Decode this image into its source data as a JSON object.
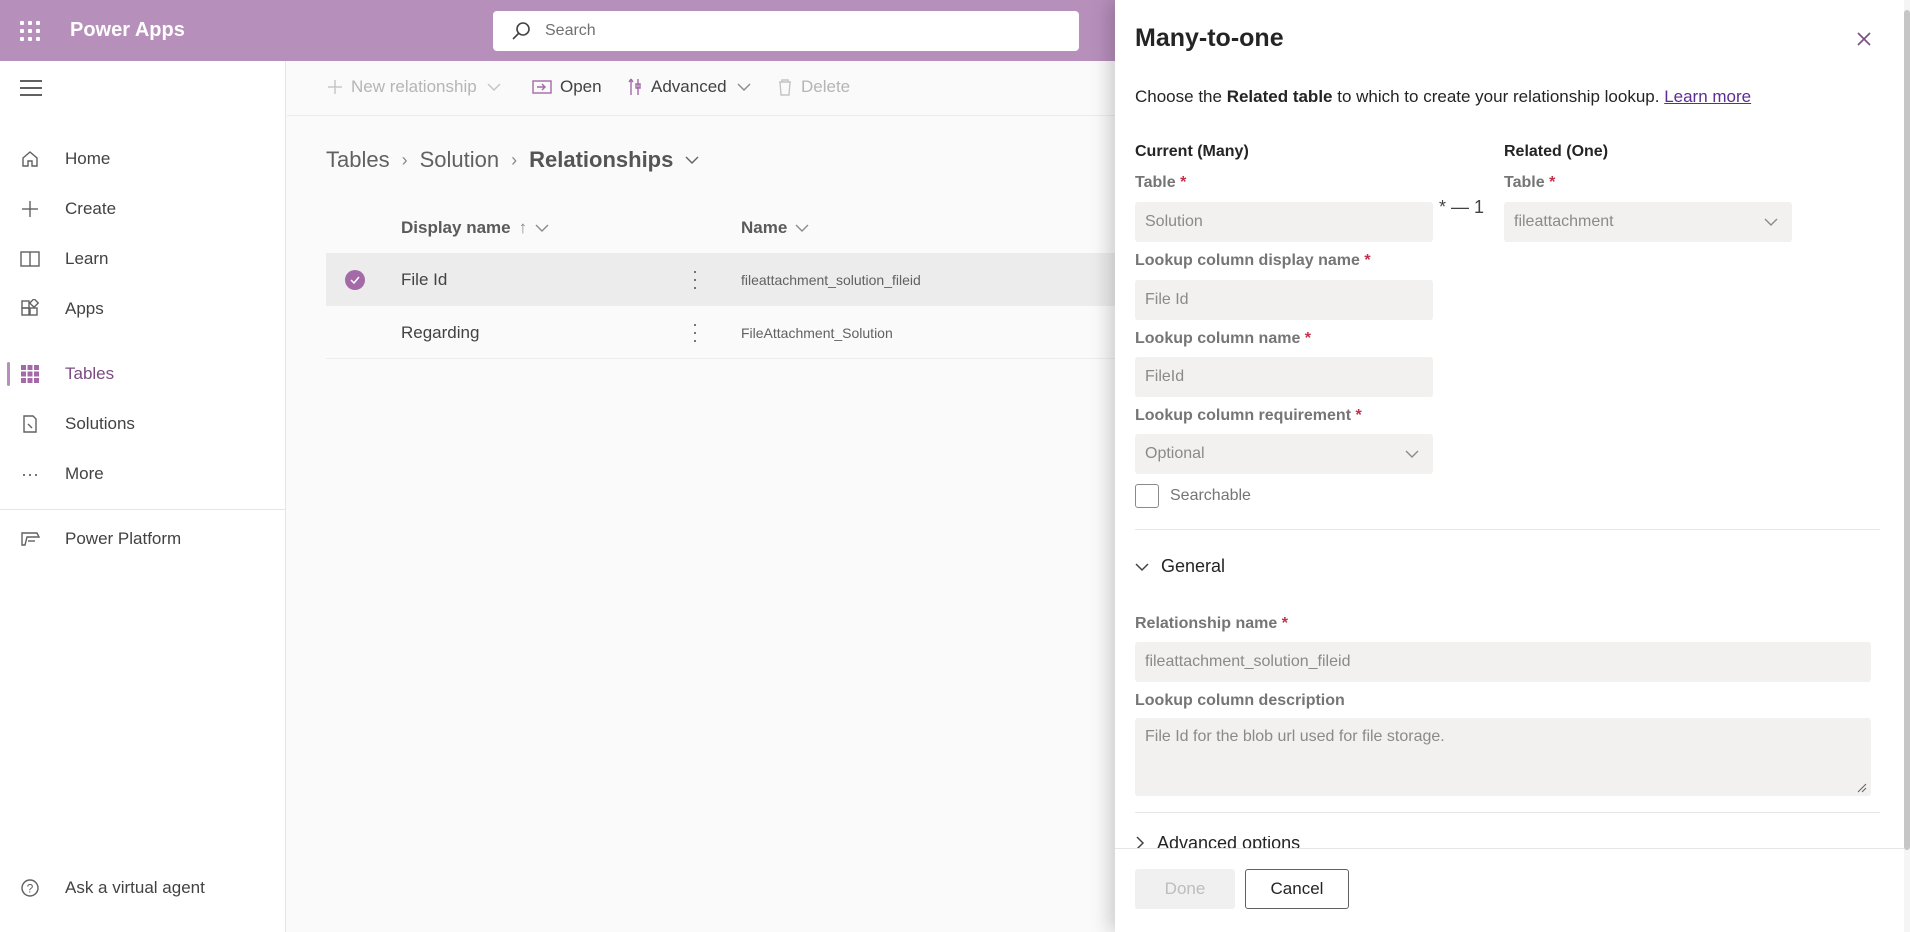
{
  "app": {
    "title": "Power Apps"
  },
  "search": {
    "placeholder": "Search"
  },
  "nav": {
    "items": [
      {
        "id": "home",
        "label": "Home",
        "icon": "home-icon"
      },
      {
        "id": "create",
        "label": "Create",
        "icon": "plus-icon"
      },
      {
        "id": "learn",
        "label": "Learn",
        "icon": "book-icon"
      },
      {
        "id": "apps",
        "label": "Apps",
        "icon": "apps-icon"
      },
      {
        "id": "tables",
        "label": "Tables",
        "icon": "table-grid-icon",
        "active": true
      },
      {
        "id": "solutions",
        "label": "Solutions",
        "icon": "solutions-icon"
      },
      {
        "id": "more",
        "label": "More",
        "icon": "more-icon"
      },
      {
        "id": "power-platform",
        "label": "Power Platform",
        "icon": "power-platform-icon"
      },
      {
        "id": "virtual-agent",
        "label": "Ask a virtual agent",
        "icon": "help-icon"
      }
    ]
  },
  "commands": {
    "new_relationship": "New relationship",
    "open": "Open",
    "advanced": "Advanced",
    "delete": "Delete"
  },
  "breadcrumb": {
    "tables": "Tables",
    "solution": "Solution",
    "current": "Relationships"
  },
  "grid": {
    "col_display_name": "Display name",
    "col_name": "Name",
    "sort_indicator": "↑",
    "rows": [
      {
        "display_name": "File Id",
        "name": "fileattachment_solution_fileid",
        "selected": true
      },
      {
        "display_name": "Regarding",
        "name": "FileAttachment_Solution",
        "selected": false
      }
    ]
  },
  "panel": {
    "title": "Many-to-one",
    "intro_prefix": "Choose the ",
    "intro_bold": "Related table",
    "intro_suffix": " to which to create your relationship lookup. ",
    "learn_more": "Learn more",
    "current_heading": "Current (Many)",
    "related_heading": "Related (One)",
    "table_label": "Table",
    "required_mark": "*",
    "current_table_value": "Solution",
    "relation_separator": "* — 1",
    "related_table_value": "fileattachment",
    "lookup_display_label": "Lookup column display name",
    "lookup_display_value": "File Id",
    "lookup_name_label": "Lookup column name",
    "lookup_name_value": "FileId",
    "lookup_req_label": "Lookup column requirement",
    "lookup_req_value": "Optional",
    "searchable_label": "Searchable",
    "general_label": "General",
    "rel_name_label": "Relationship name",
    "rel_name_value": "fileattachment_solution_fileid",
    "lookup_desc_label": "Lookup column description",
    "lookup_desc_value": "File Id for the blob url used for file storage.",
    "advanced_label": "Advanced options",
    "done_label": "Done",
    "cancel_label": "Cancel"
  },
  "colors": {
    "header_bg": "#b78fbb",
    "accent": "#a46aa8",
    "required": "#c4314b",
    "link": "#5c2e91"
  }
}
